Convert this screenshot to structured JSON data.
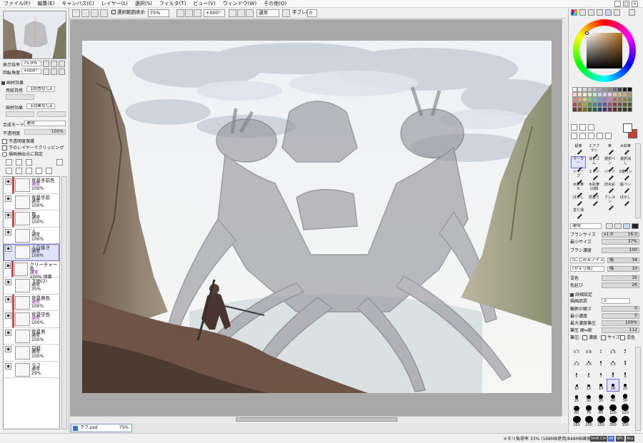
{
  "menu": [
    "ファイル(F)",
    "編集(E)",
    "キャンバス(C)",
    "レイヤー(L)",
    "選択(S)",
    "フィルタ(T)",
    "ビュー(V)",
    "ウィンドウ(W)",
    "その他(O)"
  ],
  "toolbar": {
    "selection_toggle_label": "選択範囲表示",
    "zoom_value": "75%",
    "rotation_value": "+000°",
    "blend_mode": "通常",
    "stabilizer_label": "手ブレ補正",
    "stabilizer_value": "0"
  },
  "navigator": {
    "zoom_label": "表示倍率",
    "zoom_value": "75.0%",
    "rotation_label": "回転角度",
    "rotation_value": "+000°"
  },
  "layer_props": {
    "effects_header": "画材効果",
    "paper_label": "用紙質感",
    "paper_value": "【質感なし】",
    "effect_label": "画材効果",
    "effect_value": "【効果なし】",
    "blend_label": "合成モード",
    "blend_value": "通常",
    "opacity_label": "不透明度",
    "opacity_value": "100%",
    "checks": [
      "不透明度保護",
      "下のレイヤーでクリッピング",
      "描画抽出元に指定"
    ]
  },
  "layers": [
    {
      "name": "背景手前色",
      "mode": "通常",
      "mode_color": "purple",
      "opacity": "100%",
      "clip": true,
      "selected": false
    },
    {
      "name": "背景手前",
      "mode": "通常",
      "mode_color": "",
      "opacity": "100%",
      "clip": false,
      "selected": false
    },
    {
      "name": "色",
      "mode": "通常",
      "mode_color": "",
      "opacity": "100%",
      "clip": true,
      "selected": false
    },
    {
      "name": "人",
      "mode": "通常",
      "mode_color": "",
      "opacity": "100%",
      "clip": false,
      "selected": false
    },
    {
      "name": "人白抜き",
      "mode": "通常",
      "mode_color": "",
      "opacity": "100%",
      "clip": false,
      "selected": true
    },
    {
      "name": "クリーチャー色",
      "mode": "通常",
      "mode_color": "purple",
      "opacity": "100% 保護",
      "clip": true,
      "selected": false
    },
    {
      "name": "下地(2)",
      "mode": "通常",
      "mode_color": "",
      "opacity": "35%",
      "clip": false,
      "selected": false
    },
    {
      "name": "背景奥色",
      "mode": "通常",
      "mode_color": "purple",
      "opacity": "100%",
      "clip": true,
      "selected": false
    },
    {
      "name": "背景空色",
      "mode": "通常",
      "mode_color": "purple",
      "opacity": "100%",
      "clip": true,
      "selected": false
    },
    {
      "name": "背景奥",
      "mode": "通常",
      "mode_color": "",
      "opacity": "100%",
      "clip": false,
      "selected": false
    },
    {
      "name": "白紙",
      "mode": "通常",
      "mode_color": "",
      "opacity": "100%",
      "clip": false,
      "selected": false
    },
    {
      "name": "ラフ",
      "mode": "通常",
      "mode_color": "",
      "opacity": "29%",
      "clip": false,
      "selected": false
    }
  ],
  "tools": [
    [
      "鉛筆",
      "エアブラシ",
      "筆",
      "水彩筆"
    ],
    [
      "マーカー",
      "消しゴム",
      "選択ペン",
      "選択消し"
    ],
    [
      "シャープ",
      "エッジ",
      "バケツ",
      "2値ペン"
    ],
    [
      "水彩筆 6",
      "水彩筆 1(細)",
      "旧水彩",
      "鉛ペン"
    ],
    [
      "ぼかし",
      "厚塗り",
      "クレヨン",
      "ぼかし"
    ],
    [
      "塗り潰",
      "",
      "",
      ""
    ]
  ],
  "brush": {
    "mode": "通常",
    "size_label": "ブラシサイズ",
    "size_mult": "x1.0",
    "size_value": "16.0",
    "min_size_label": "最小サイズ",
    "min_size_value": "37%",
    "density_label": "ブラシ濃度",
    "density_value": "100",
    "shape_label": "(にじみ＆ノイズ)",
    "shape_strength_label": "強",
    "shape_strength": "34",
    "texture_label": "(やすり紙)",
    "texture_strength_label": "強",
    "texture_strength": "10",
    "mix_label": "混色",
    "mix_value": "35",
    "persist_label": "色延び",
    "persist_value": "26",
    "advanced_header": "詳細設定",
    "quality_label": "描画品質",
    "quality_value": "3",
    "edge_label": "輪郭の硬さ",
    "edge_value": "0",
    "min_density_label": "最小濃度",
    "min_density_value": "0",
    "max_pressure_label": "最大濃度筆圧",
    "max_pressure_value": "100%",
    "pressure_hard_label": "筆圧 硬⇔軟",
    "pressure_hard_value": "112",
    "pressure_label": "筆圧:",
    "pressure_checks": [
      "濃度",
      "サイズ",
      "混色"
    ]
  },
  "brush_sizes": [
    "0.7",
    "0.8",
    "1",
    "1.5",
    "2",
    "2.3",
    "2.6",
    "3",
    "3.5",
    "4",
    "5",
    "6",
    "7",
    "8",
    "9",
    "10",
    "12",
    "14",
    "16",
    "20",
    "25",
    "30",
    "35",
    "40",
    "50",
    "60",
    "70",
    "80",
    "100",
    "120",
    "160",
    "200",
    "250",
    "300",
    "350"
  ],
  "document": {
    "tab_name": "ラフ.psd",
    "zoom": "75%"
  },
  "status": {
    "memory": "メモリ負荷率 33% (168MB使用/848MB確保)",
    "badges": [
      "Shift",
      "Ctrl",
      "Alt",
      "SPC",
      "Any"
    ]
  },
  "colors": {
    "accent": "#6a6adf",
    "clip_red": "#d2453f",
    "mode_purple": "#7a1e8a",
    "current_color": "#c8402e",
    "picker_square_base": "#b3701f"
  },
  "icons": [
    "eye-icon",
    "clip-icon",
    "brush-icon",
    "search-icon",
    "hand-icon",
    "rotate-icon",
    "eyedropper-icon",
    "move-icon",
    "pen-icon",
    "new-layer-icon",
    "folder-icon",
    "trash-icon",
    "minimize-icon",
    "maximize-icon",
    "close-icon"
  ]
}
